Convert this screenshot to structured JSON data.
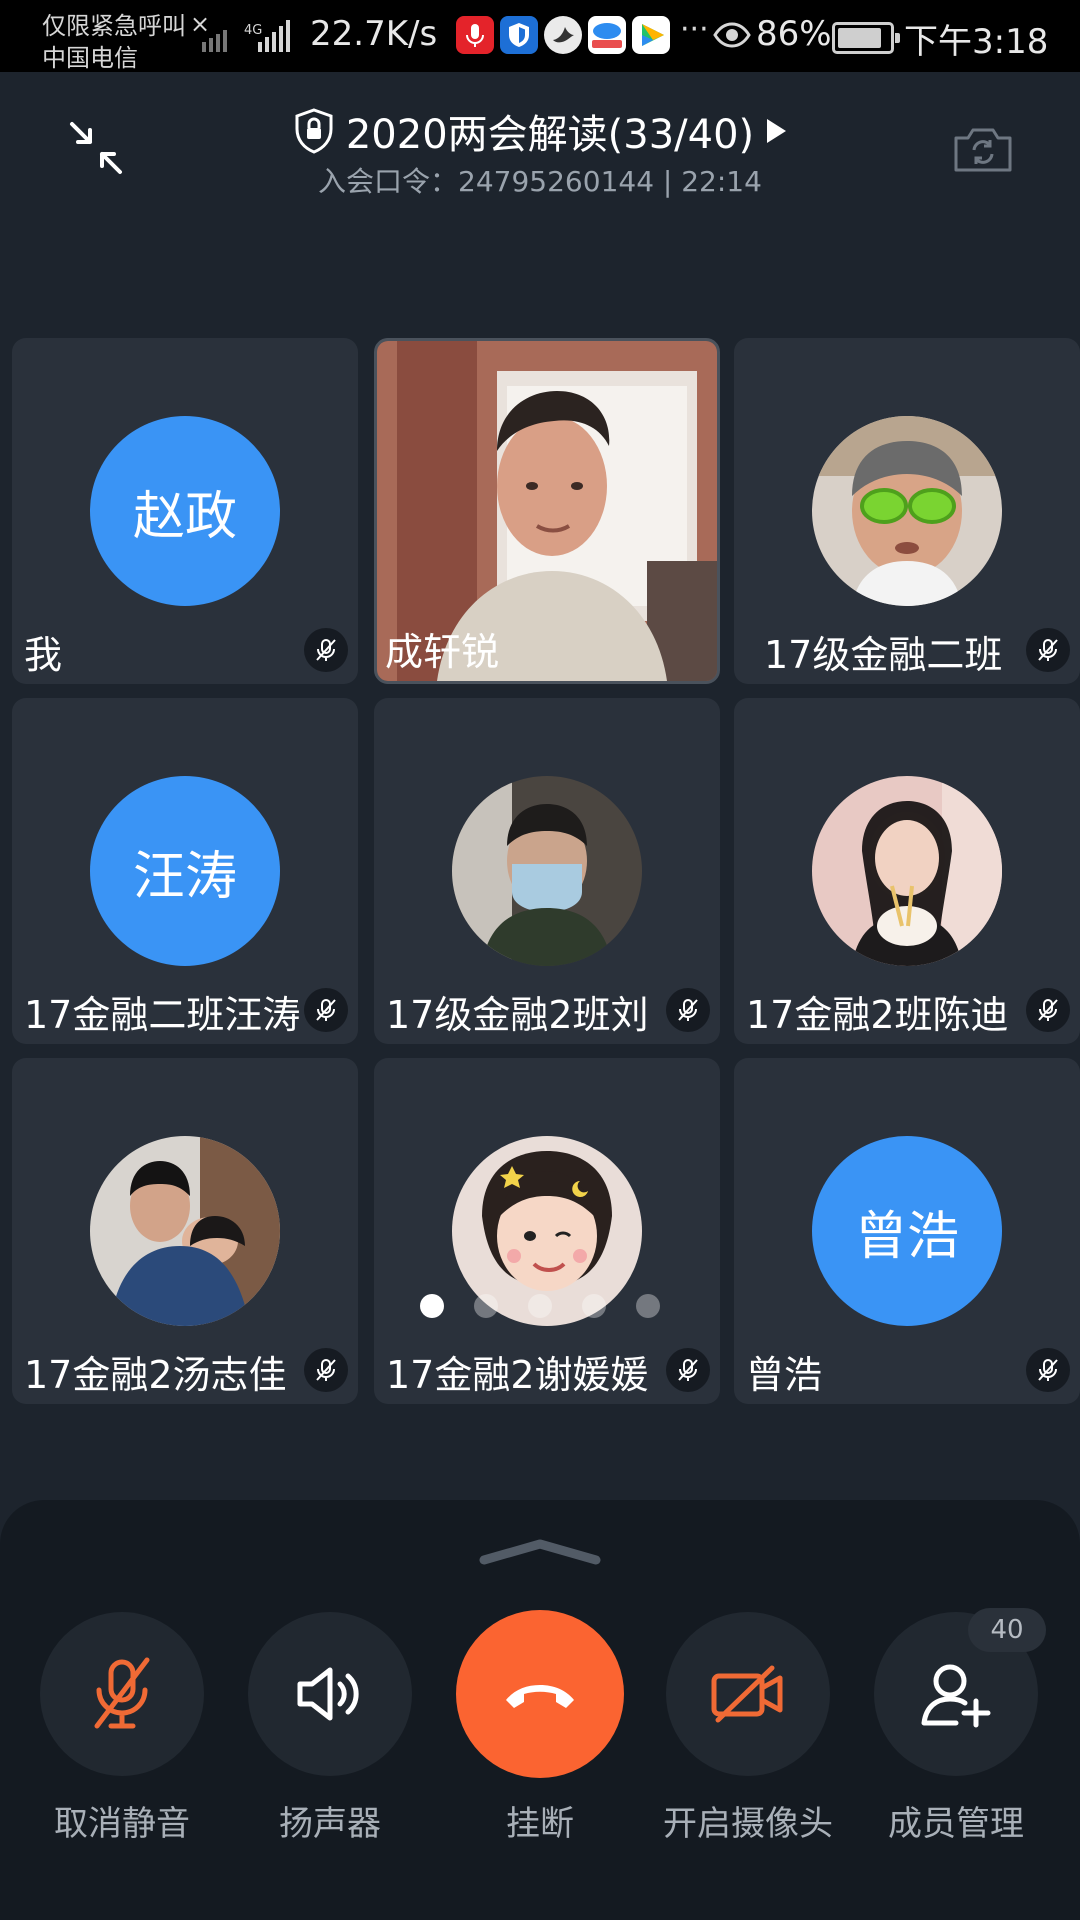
{
  "status_bar": {
    "carrier_line1": "仅限紧急呼叫",
    "carrier_line2": "中国电信",
    "dismiss": "×",
    "network_type": "4G",
    "speed": "22.7K/s",
    "more": "···",
    "battery_percent": "86%",
    "battery_level": 0.86,
    "time": "下午3:18",
    "app_icons": [
      "microphone-app-icon",
      "shield-app-icon",
      "bird-app-icon",
      "game-app-icon",
      "video-app-icon"
    ]
  },
  "header": {
    "title": "2020两会解读(33/40)",
    "subtitle": "入会口令：24795260144 | 22:14"
  },
  "participants": [
    {
      "name": "我",
      "avatar_text": "赵政",
      "kind": "text"
    },
    {
      "name": "成轩锐",
      "kind": "video"
    },
    {
      "name": "17级金融二班",
      "kind": "photo",
      "muted": true
    },
    {
      "name": "17金融二班汪涛",
      "avatar_text": "汪涛",
      "kind": "text",
      "muted": true
    },
    {
      "name": "17级金融2班刘",
      "kind": "photo",
      "muted": true
    },
    {
      "name": "17金融2班陈迪",
      "kind": "photo",
      "muted": true
    },
    {
      "name": "17金融2汤志佳",
      "kind": "photo",
      "muted": true
    },
    {
      "name": "17金融2谢媛媛",
      "kind": "photo",
      "muted": true
    },
    {
      "name": "曾浩",
      "avatar_text": "曾浩",
      "kind": "text",
      "muted": true
    }
  ],
  "pagination": {
    "pages": 5,
    "current": 1
  },
  "controls": {
    "unmute_label": "取消静音",
    "speaker_label": "扬声器",
    "hangup_label": "挂断",
    "camera_label": "开启摄像头",
    "members_label": "成员管理",
    "members_count": "40"
  },
  "colors": {
    "background": "#1d242d",
    "tile": "#2a313b",
    "avatar_blue": "#3a94f5",
    "accent_orange": "#fb6431",
    "panel": "#141a21"
  }
}
